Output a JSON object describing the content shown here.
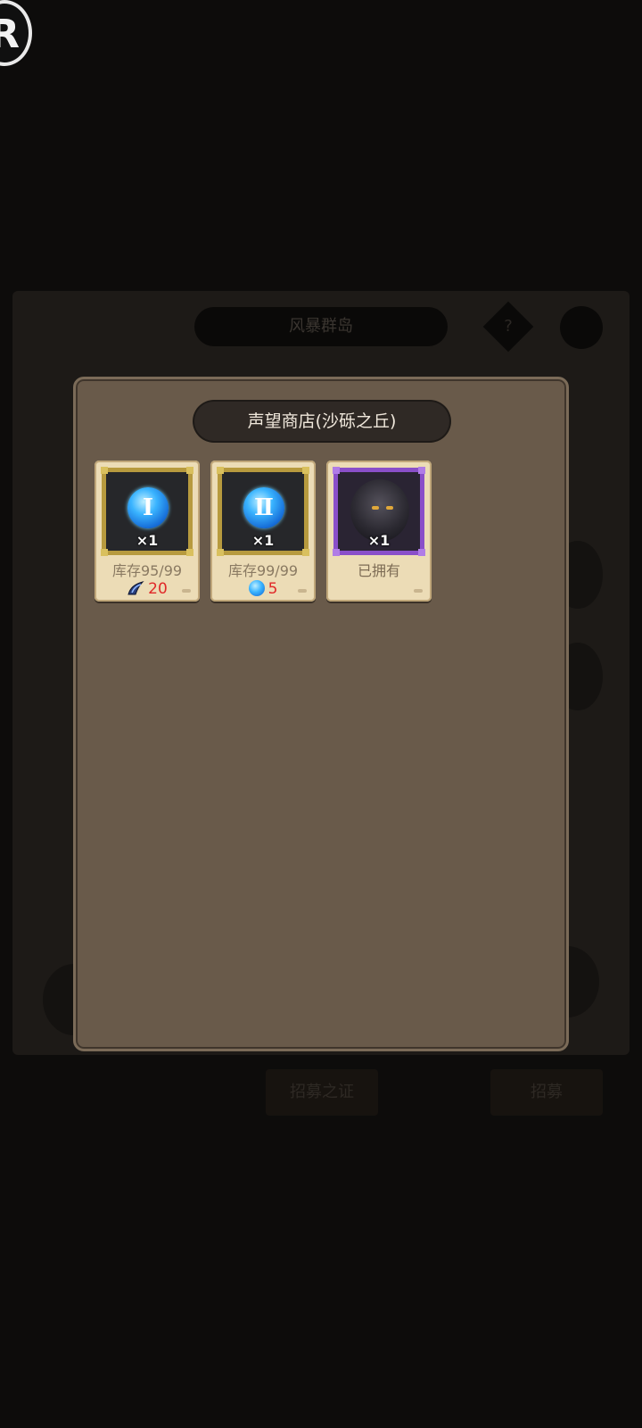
{
  "background": {
    "title": "风暴群岛",
    "help_glyph": "?",
    "button_left": "招募之证",
    "button_right": "招募"
  },
  "logo": {
    "letter": "R"
  },
  "shop": {
    "title": "声望商店(沙砾之丘)",
    "items": [
      {
        "icon": "rune-I-icon",
        "glyph": "Ⅰ",
        "quantity": "×1",
        "stock": "库存95/99",
        "currency_icon": "wing-token-icon",
        "price": "20"
      },
      {
        "icon": "rune-II-icon",
        "glyph": "Ⅱ",
        "quantity": "×1",
        "stock": "库存99/99",
        "currency_icon": "blue-rune-token-icon",
        "price": "5"
      },
      {
        "icon": "dark-helmet-icon",
        "quantity": "×1",
        "status": "已拥有"
      }
    ]
  },
  "colors": {
    "panel": "#695a4a",
    "title_pill": "#2f2925",
    "card": "#ecdcb6",
    "gold_frame": "#b79a3e",
    "purple_frame": "#8a4fc9",
    "price_red": "#e02828"
  }
}
